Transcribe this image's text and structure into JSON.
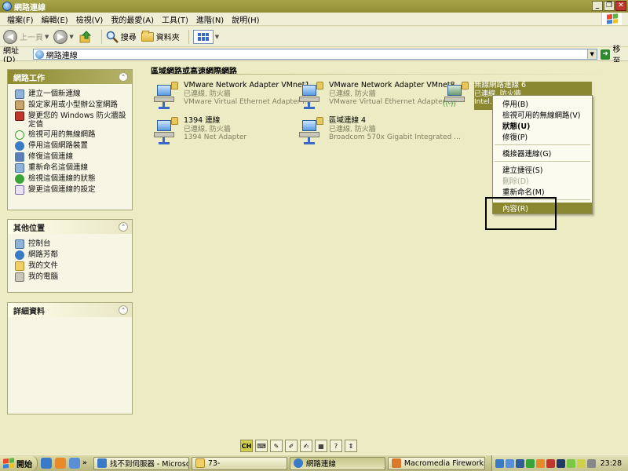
{
  "window": {
    "title": "網路連線"
  },
  "menubar": {
    "items": [
      "檔案(F)",
      "編輯(E)",
      "檢視(V)",
      "我的最愛(A)",
      "工具(T)",
      "進階(N)",
      "說明(H)"
    ]
  },
  "toolbar": {
    "back_label": "上一頁",
    "search_label": "搜尋",
    "folders_label": "資料夾"
  },
  "address": {
    "label": "網址(D)",
    "value": "網路連線",
    "go_label": "移至"
  },
  "left_panel": {
    "network_tasks": {
      "title": "網路工作",
      "items": [
        "建立一個新連線",
        "設定家用或小型辦公室網路",
        "變更您的 Windows 防火牆設定值",
        "檢視可用的無線網路",
        "停用這個網路裝置",
        "修復這個連線",
        "重新命名這個連線",
        "檢視這個連線的狀態",
        "變更這個連線的設定"
      ]
    },
    "other_places": {
      "title": "其他位置",
      "items": [
        "控制台",
        "網路芳鄰",
        "我的文件",
        "我的電腦"
      ]
    },
    "details": {
      "title": "詳細資料"
    }
  },
  "main": {
    "section_title": "區域網路或高速網際網路",
    "connections": [
      {
        "name": "VMware Network Adapter VMnet1",
        "status": "已連線, 防火牆",
        "device": "VMware Virtual Ethernet Adapter f..."
      },
      {
        "name": "VMware Network Adapter VMnet8",
        "status": "已連線, 防火牆",
        "device": "VMware Virtual Ethernet Adapter f..."
      },
      {
        "name": "無線網路連線 6",
        "status": "已連線, 防火牆",
        "device": "Intel..."
      },
      {
        "name": "1394 連線",
        "status": "已連線, 防火牆",
        "device": "1394 Net Adapter"
      },
      {
        "name": "區域連線 4",
        "status": "已連線, 防火牆",
        "device": "Broadcom 570x Gigabit Integrated ..."
      }
    ]
  },
  "context_menu": {
    "items": [
      {
        "label": "停用(B)",
        "style": "normal"
      },
      {
        "label": "檢視可用的無線網路(V)",
        "style": "normal"
      },
      {
        "label": "狀態(U)",
        "style": "bold"
      },
      {
        "label": "修復(P)",
        "style": "normal"
      },
      {
        "label": "橋接器連線(G)",
        "style": "normal"
      },
      {
        "label": "建立捷徑(S)",
        "style": "normal"
      },
      {
        "label": "刪除(D)",
        "style": "disabled"
      },
      {
        "label": "重新命名(M)",
        "style": "normal"
      },
      {
        "label": "內容(R)",
        "style": "highlighted"
      }
    ]
  },
  "language_bar": {
    "ime_label": "CH"
  },
  "taskbar": {
    "start_label": "開始",
    "buttons": [
      {
        "label": "找不到伺服器 - Microso..."
      },
      {
        "label": "73-"
      },
      {
        "label": "網路連線"
      },
      {
        "label": "Macromedia Fireworks M..."
      }
    ],
    "clock": "23:28"
  }
}
